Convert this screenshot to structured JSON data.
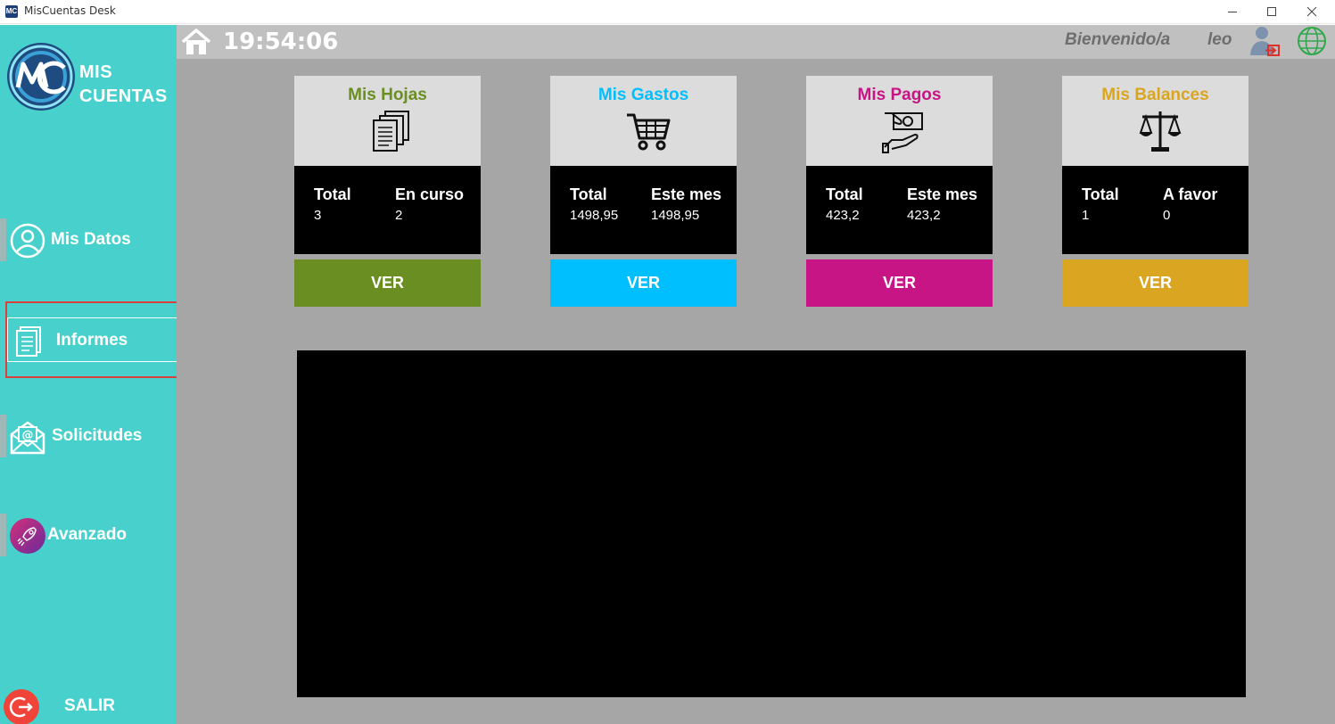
{
  "window": {
    "title": "MisCuentas Desk",
    "app_icon_text": "MC"
  },
  "sidebar": {
    "logo_text_line1": "MIS",
    "logo_text_line2": "CUENTAS",
    "items": [
      {
        "label": "Mis Datos",
        "icon": "user-circle-icon"
      },
      {
        "label": "Informes",
        "icon": "report-icon"
      },
      {
        "label": "Solicitudes",
        "icon": "email-icon"
      },
      {
        "label": "Avanzado",
        "icon": "rocket-icon"
      }
    ],
    "selected_item": "Informes",
    "logout_label": "SALIR"
  },
  "header": {
    "clock": "19:54:06",
    "welcome": "Bienvenido/a",
    "username": "leo"
  },
  "cards": [
    {
      "title": "Mis Hojas",
      "icon": "documents-icon",
      "label1": "Total",
      "value1": "3",
      "label2": "En curso",
      "value2": "2",
      "button": "VER",
      "color": "#6b8e23"
    },
    {
      "title": "Mis Gastos",
      "icon": "shopping-cart-icon",
      "label1": "Total",
      "value1": "1498,95",
      "label2": "Este mes",
      "value2": "1498,95",
      "button": "VER",
      "color": "#00bfff"
    },
    {
      "title": "Mis Pagos",
      "icon": "payment-hand-icon",
      "label1": "Total",
      "value1": "423,2",
      "label2": "Este mes",
      "value2": "423,2",
      "button": "VER",
      "color": "#c71585"
    },
    {
      "title": "Mis Balances",
      "icon": "scale-icon",
      "label1": "Total",
      "value1": "1",
      "label2": "A favor",
      "value2": "0",
      "button": "VER",
      "color": "#daa520"
    }
  ],
  "colors": {
    "sidebar": "#48d1cc",
    "topbar": "#c0c0c0",
    "main_bg": "#a6a6a6",
    "card_head": "#dcdcdc",
    "logout": "#f0443a"
  }
}
